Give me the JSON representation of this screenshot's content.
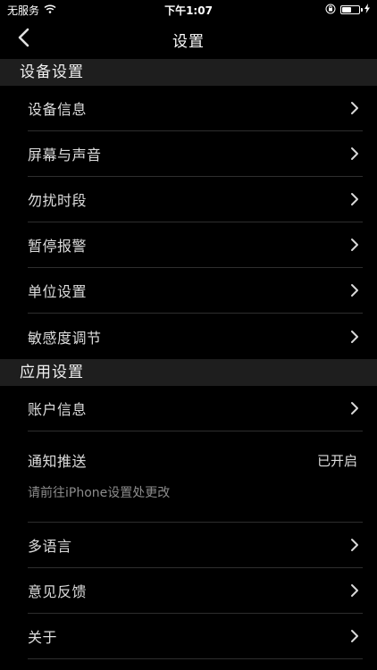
{
  "status_bar": {
    "carrier": "无服务",
    "time": "下午1:07",
    "battery_level": 0.55
  },
  "nav": {
    "title": "设置"
  },
  "sections": [
    {
      "title": "设备设置",
      "items": [
        {
          "label": "设备信息"
        },
        {
          "label": "屏幕与声音"
        },
        {
          "label": "勿扰时段"
        },
        {
          "label": "暂停报警"
        },
        {
          "label": "单位设置"
        },
        {
          "label": "敏感度调节"
        }
      ]
    },
    {
      "title": "应用设置",
      "items": [
        {
          "label": "账户信息"
        },
        {
          "label": "通知推送",
          "value": "已开启",
          "hint": "请前往iPhone设置处更改"
        },
        {
          "label": "多语言"
        },
        {
          "label": "意见反馈"
        },
        {
          "label": "关于"
        }
      ]
    }
  ],
  "colors": {
    "background": "#000000",
    "section_header": "#1e1e1e",
    "divider": "#2e2e2e",
    "hint_text": "#8c8c8c"
  },
  "icons": {
    "back": "chevron-left-icon",
    "row": "chevron-right-icon",
    "wifi": "wifi-icon",
    "lock": "orientation-lock-icon",
    "battery": "battery-icon",
    "charging": "charging-bolt-icon"
  }
}
